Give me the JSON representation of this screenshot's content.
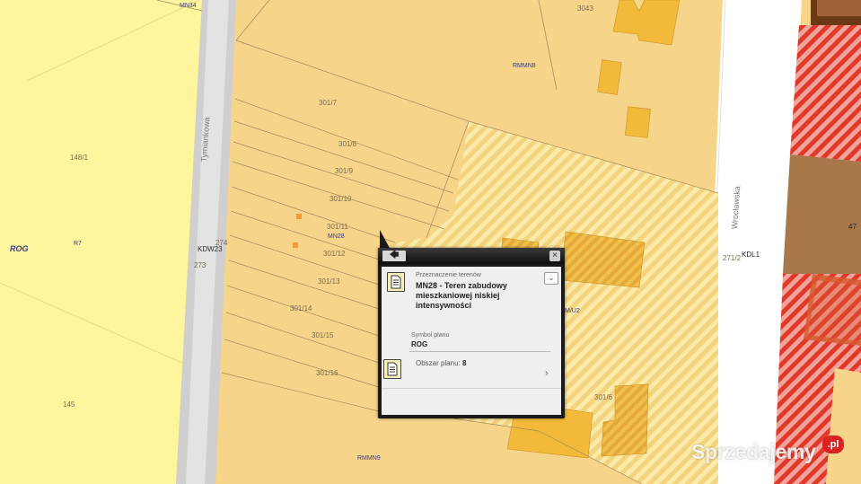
{
  "map": {
    "labels": {
      "mn34": "MN34",
      "n3043": "3043",
      "rmmn8": "RMMN8",
      "n3017": "301/7",
      "n3018": "301/8",
      "n3019": "301/9",
      "n30110": "301/10",
      "n30111": "301/11",
      "mn28": "MN28",
      "n30112": "301/12",
      "n30113": "301/13",
      "n30114": "301/14",
      "n30115": "301/15",
      "n30116": "301/16",
      "n1481": "148/1",
      "rog": "ROG",
      "r7": "R7",
      "kdw23": "KDW23",
      "n274": "274",
      "n273": "273",
      "n145": "145",
      "rmmn9": "RMMN9",
      "kdl1": "KDL1",
      "n2712": "271/2",
      "n47": "47",
      "mu2": "M/U2",
      "n3016": "301/6",
      "tymiankowa": "Tymiankowa",
      "wroclawska": "Wrocławska"
    }
  },
  "popup": {
    "back_label": "🡄",
    "close_label": "×",
    "header": "Przeznaczenie terenów",
    "title": "MN28 - Teren zabudowy mieszkaniowej niskiej intensywności",
    "symbol_label": "Symbol planu",
    "symbol_value": "ROG",
    "area_label": "Obszar planu:",
    "area_value": "8"
  },
  "watermark": {
    "text": "Sprzedajemy",
    "suffix": ".pl"
  },
  "colors": {
    "yellow_zone": "#fff59c",
    "orange_zone": "#f6d48a",
    "road": "#cfcfcf",
    "hatch": "#f6e39a",
    "building": "#f3b93a",
    "red_hatch": "#e53a2c",
    "brown": "#a0703e"
  }
}
